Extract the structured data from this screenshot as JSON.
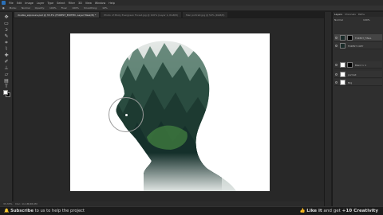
{
  "menubar": {
    "items": [
      "File",
      "Edit",
      "Image",
      "Layer",
      "Type",
      "Select",
      "Filter",
      "3D",
      "View",
      "Window",
      "Help"
    ]
  },
  "options": {
    "mode_label": "Mode:",
    "mode_value": "Normal",
    "opacity_label": "Opacity:",
    "opacity_value": "100%",
    "flow_label": "Flow:",
    "flow_value": "100%",
    "smoothing_label": "Smoothing:",
    "smoothing_value": "10%"
  },
  "tabs": [
    {
      "label": "double_exposure.psd @ 33.3% (FOREST_EDITED, Layer Mask/8) *",
      "active": true
    },
    {
      "label": "Photo of Misty Evergreen Forest.jpg @ 100% (Layer 1, RGB/8)",
      "active": false
    },
    {
      "label": "Man portrait.jpg @ 50% (RGB/8)",
      "active": false
    }
  ],
  "layers_panel": {
    "tabs": [
      "Layers",
      "Channels",
      "Paths"
    ],
    "blend": "Normal",
    "opacity": "100%",
    "layers": [
      {
        "name": "FOREST_FINAL",
        "thumb": "dark",
        "selected": true,
        "has_mask": true
      },
      {
        "name": "FOREST COPY",
        "thumb": "dark",
        "selected": false,
        "has_mask": false
      },
      {
        "name": "Blend > 1 ",
        "thumb": "light",
        "selected": false,
        "has_mask": true
      },
      {
        "name": "portrait",
        "thumb": "light",
        "selected": false,
        "has_mask": false
      },
      {
        "name": "Bkg",
        "thumb": "light",
        "selected": false,
        "has_mask": false
      }
    ]
  },
  "status": {
    "zoom": "33.33%",
    "doc": "Doc: 11.1M/48.0M"
  },
  "banner": {
    "left_bold": "Subscribe",
    "left_rest": " to us to help the project",
    "right_bold": "Like it",
    "right_rest": " and get ",
    "right_bold2": "+10 Creativity"
  },
  "colors": {
    "canvas_bg": "#ffffff",
    "forest_dark": "#15302b",
    "forest_mid": "#2f5a47",
    "fog": "#dfe4e2"
  }
}
